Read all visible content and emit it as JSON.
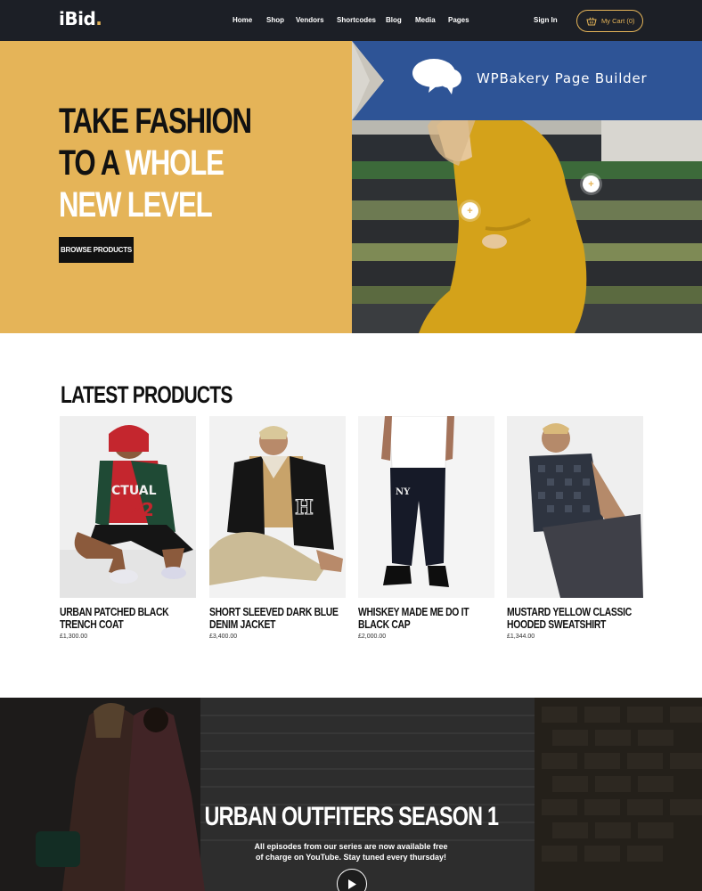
{
  "nav": {
    "logo": "iBid",
    "logo_dot": ".",
    "items": [
      "Home",
      "Shop",
      "Vendors",
      "Shortcodes",
      "Blog",
      "Media",
      "Pages"
    ],
    "signin": "Sign In",
    "cart_label": "My Cart (0)",
    "cart_icon": "basket-icon"
  },
  "hero": {
    "line1": "TAKE FASHION",
    "line2_dark": "TO A ",
    "line2_white": "WHOLE",
    "line3": "NEW LEVEL",
    "button": "BROWSE PRODUCTS",
    "banner_text": "WPBakery Page Builder",
    "hotspot_symbol": "+"
  },
  "latest": {
    "title": "LATEST PRODUCTS",
    "products": [
      {
        "name": "URBAN PATCHED BLACK TRENCH COAT",
        "price": "£1,300.00"
      },
      {
        "name": "SHORT SLEEVED DARK BLUE DENIM JACKET",
        "price": "£3,400.00"
      },
      {
        "name": "WHISKEY MADE ME DO IT BLACK CAP",
        "price": "£2,000.00"
      },
      {
        "name": "MUSTARD YELLOW CLASSIC HOODED SWEATSHIRT",
        "price": "£1,344.00"
      }
    ]
  },
  "video": {
    "title": "URBAN OUTFITERS SEASON 1",
    "text": "All episodes from our series are now available free of charge on YouTube. Stay tuned every thursday!",
    "play_icon": "play-icon"
  },
  "colors": {
    "accent": "#e5b458",
    "nav_bg": "#1c1f26",
    "banner_blue": "#2e5496"
  }
}
